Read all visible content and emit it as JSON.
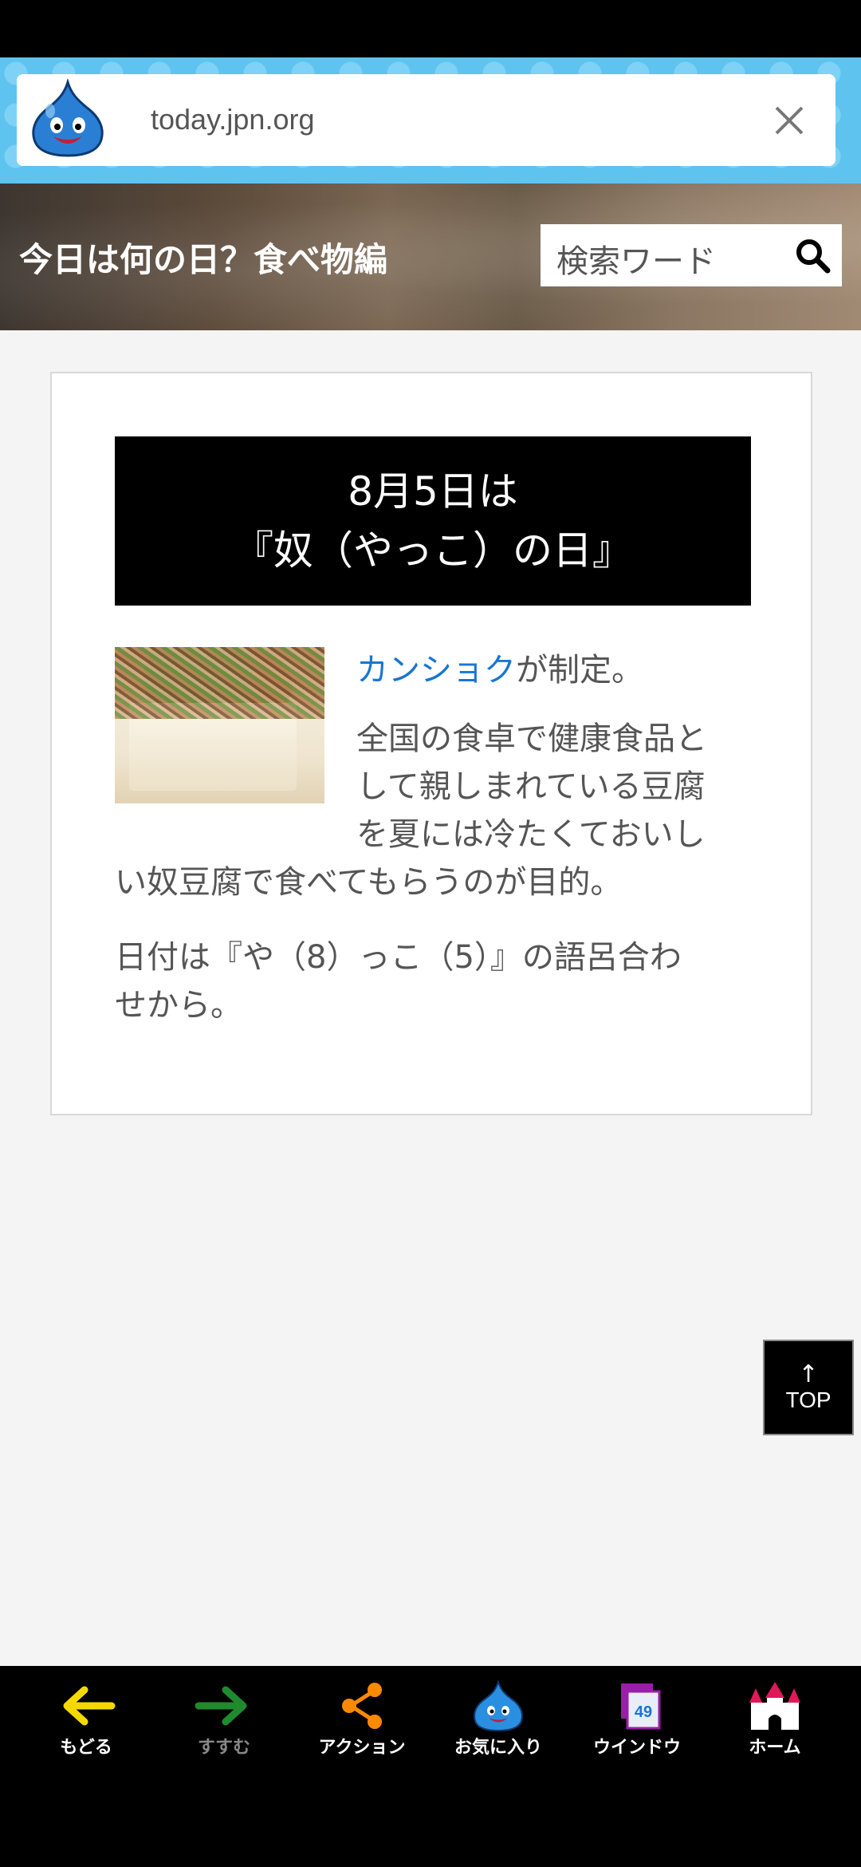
{
  "browser": {
    "url": "today.jpn.org"
  },
  "header": {
    "site_title": "今日は何の日？食べ物編",
    "search_placeholder": "検索ワード"
  },
  "article": {
    "title_line1": "8月5日は",
    "title_line2": "『奴（やっこ）の日』",
    "maker_link": "カンショク",
    "maker_suffix": "が制定。",
    "para2_line1": "全国の食卓で健康食品と",
    "para2_line2": "して親しまれている豆腐",
    "para2_line3": "を夏には冷たくておいし",
    "para2_line4": "い奴豆腐で食べてもらうのが目的。",
    "para3_line1": "日付は『や（8）っこ（5）』の語呂合わ",
    "para3_line2": "せから。"
  },
  "top_button": {
    "arrow": "↑",
    "label": "TOP"
  },
  "bottom_nav": {
    "back": "もどる",
    "forward": "すすむ",
    "action": "アクション",
    "favorites": "お気に入り",
    "window": "ウインドウ",
    "window_count": "49",
    "home": "ホーム"
  },
  "colors": {
    "link": "#1976d2",
    "url_bar_bg": "#5ec3ef",
    "back_arrow": "#f5d800",
    "forward_arrow": "#1f8a2e",
    "action": "#ff8a00"
  }
}
